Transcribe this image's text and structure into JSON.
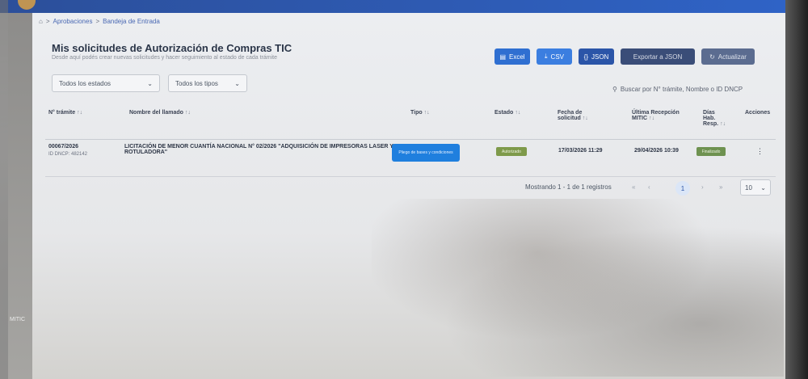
{
  "breadcrumb": {
    "home": "⌂",
    "sep1": ">",
    "item1": "Aprobaciones",
    "sep2": ">",
    "item2": "Bandeja de Entrada"
  },
  "header": {
    "title": "Mis solicitudes de Autorización de Compras TIC",
    "subtitle": "Desde aquí podés crear nuevas solicitudes y hacer seguimiento al estado de cada trámite"
  },
  "toolbar": {
    "excel_label": "Excel",
    "csv_label": "CSV",
    "json_label": "JSON",
    "export_label": "Exportar a JSON",
    "refresh_label": "Actualizar"
  },
  "filters": {
    "status_selected": "Todos los estados",
    "types_selected": "Todos los tipos",
    "search_placeholder": "Buscar por N° trámite, Nombre o ID DNCP"
  },
  "table": {
    "headers": {
      "tramite": "N° trámite",
      "nombre": "Nombre del llamado",
      "tipo": "Tipo",
      "estado": "Estado",
      "fecha": "Fecha de solicitud",
      "ultima": "Última Recepción MITIC",
      "dias": "Días Hab. Resp.",
      "acciones": "Acciones"
    },
    "sort_glyph": "↑↓",
    "rows": [
      {
        "tramite": "00067/2026",
        "id_dncp": "ID DNCP: 482142",
        "nombre": "LICITACIÓN DE MENOR CUANTÍA NACIONAL N° 02/2026 \"ADQUISICIÓN DE IMPRESORAS LASER Y ROTULADORA\"",
        "tipo": "Pliego de bases y condiciones",
        "estado": "Autorizado",
        "fecha": "17/03/2026 11:29",
        "ultima": "29/04/2026 10:39",
        "dias": "Finalizado",
        "acciones": "⋮"
      }
    ]
  },
  "pagination": {
    "summary": "Mostrando 1 - 1 de 1 registros",
    "first": "«",
    "prev": "‹",
    "current": "1",
    "next": "›",
    "last": "»",
    "page_size": "10"
  },
  "sidebar": {
    "bottom_label": "MITIC"
  },
  "colors": {
    "primary": "#2f6fd1",
    "tipo_badge": "#1f7fde",
    "estado_badge": "#7e9a4a",
    "topbar": "#2c4f9a"
  },
  "icons": [
    "home-icon",
    "file-excel-icon",
    "download-icon",
    "json-icon",
    "refresh-icon",
    "chevron-down-icon",
    "search-icon",
    "more-icon"
  ]
}
